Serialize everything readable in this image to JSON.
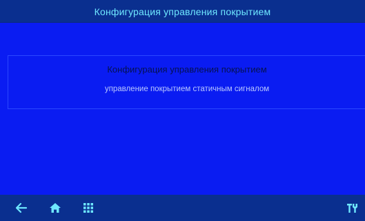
{
  "header": {
    "title": "Конфигурация управления покрытием"
  },
  "panel": {
    "heading": "Конфигурация управления покрытием",
    "description": "управление покрытием статичным сигналом"
  },
  "bottom_nav": {
    "items": [
      {
        "icon": "back-arrow-icon"
      },
      {
        "icon": "home-icon"
      },
      {
        "icon": "grid-menu-icon"
      },
      {
        "icon": "tools-icon"
      }
    ]
  },
  "colors": {
    "background": "#0a1cf2",
    "bars": "#0a2f8f",
    "title_text": "#6ee7ff",
    "heading_text": "#06124f",
    "body_text": "#b9c7ff"
  }
}
